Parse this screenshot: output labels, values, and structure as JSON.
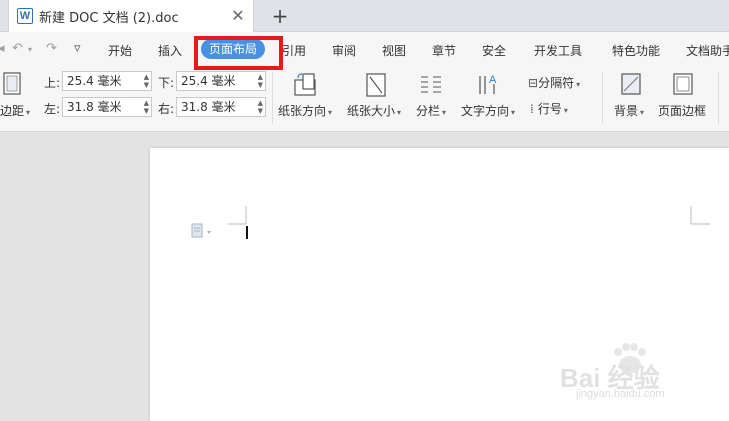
{
  "tab": {
    "title": "新建 DOC 文档 (2).doc",
    "close": "✕",
    "add": "+"
  },
  "menu": {
    "items": [
      "开始",
      "插入",
      "页面布局",
      "引用",
      "审阅",
      "视图",
      "章节",
      "安全",
      "开发工具",
      "特色功能",
      "文档助手"
    ],
    "active": "页面布局"
  },
  "ribbon": {
    "margin_button": "边距",
    "top_label": "上:",
    "top_value": "25.4 毫米",
    "bottom_label": "下:",
    "bottom_value": "25.4 毫米",
    "left_label": "左:",
    "left_value": "31.8 毫米",
    "right_label": "右:",
    "right_value": "31.8 毫米",
    "orientation": "纸张方向",
    "size": "纸张大小",
    "columns": "分栏",
    "text_direction": "文字方向",
    "separator": "分隔符",
    "line_number": "行号",
    "background": "背景",
    "page_border": "页面边框"
  },
  "watermark": {
    "brand": "Bai 经验",
    "url": "jingyan.baidu.com"
  },
  "colors": {
    "active_tab": "#4a90e2",
    "highlight": "#e31b1b"
  }
}
